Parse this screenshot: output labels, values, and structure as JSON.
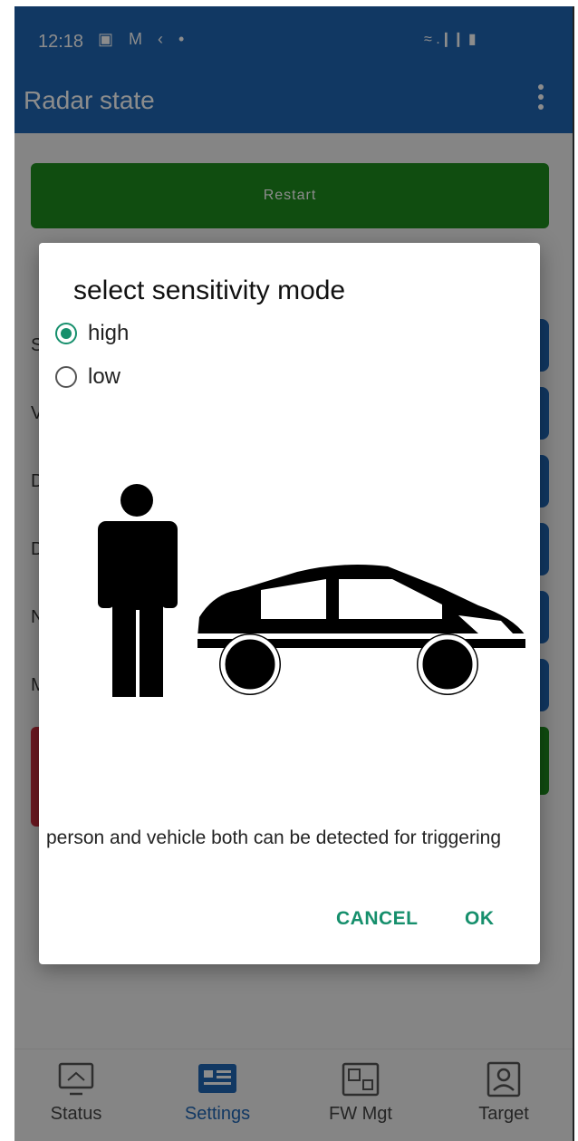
{
  "status_bar": {
    "time": "12:18",
    "left_icons": "▣ M ‹ •",
    "right_icons": "≈ .❙❙ ▮"
  },
  "app_bar": {
    "title": "Radar state"
  },
  "background": {
    "restart_label": "Restart"
  },
  "bottom_nav": {
    "items": [
      {
        "label": "Status"
      },
      {
        "label": "Settings"
      },
      {
        "label": "FW Mgt"
      },
      {
        "label": "Target"
      }
    ],
    "active": "Settings"
  },
  "dialog": {
    "title": "select sensitivity mode",
    "options": [
      {
        "label": "high",
        "selected": true
      },
      {
        "label": "low",
        "selected": false
      }
    ],
    "description": "person and vehicle both can be detected for triggering",
    "cancel_label": "CANCEL",
    "ok_label": "OK"
  },
  "colors": {
    "app_bar": "#1f66b5",
    "accent": "#168f6c",
    "restart_green": "#1e8c1e"
  }
}
